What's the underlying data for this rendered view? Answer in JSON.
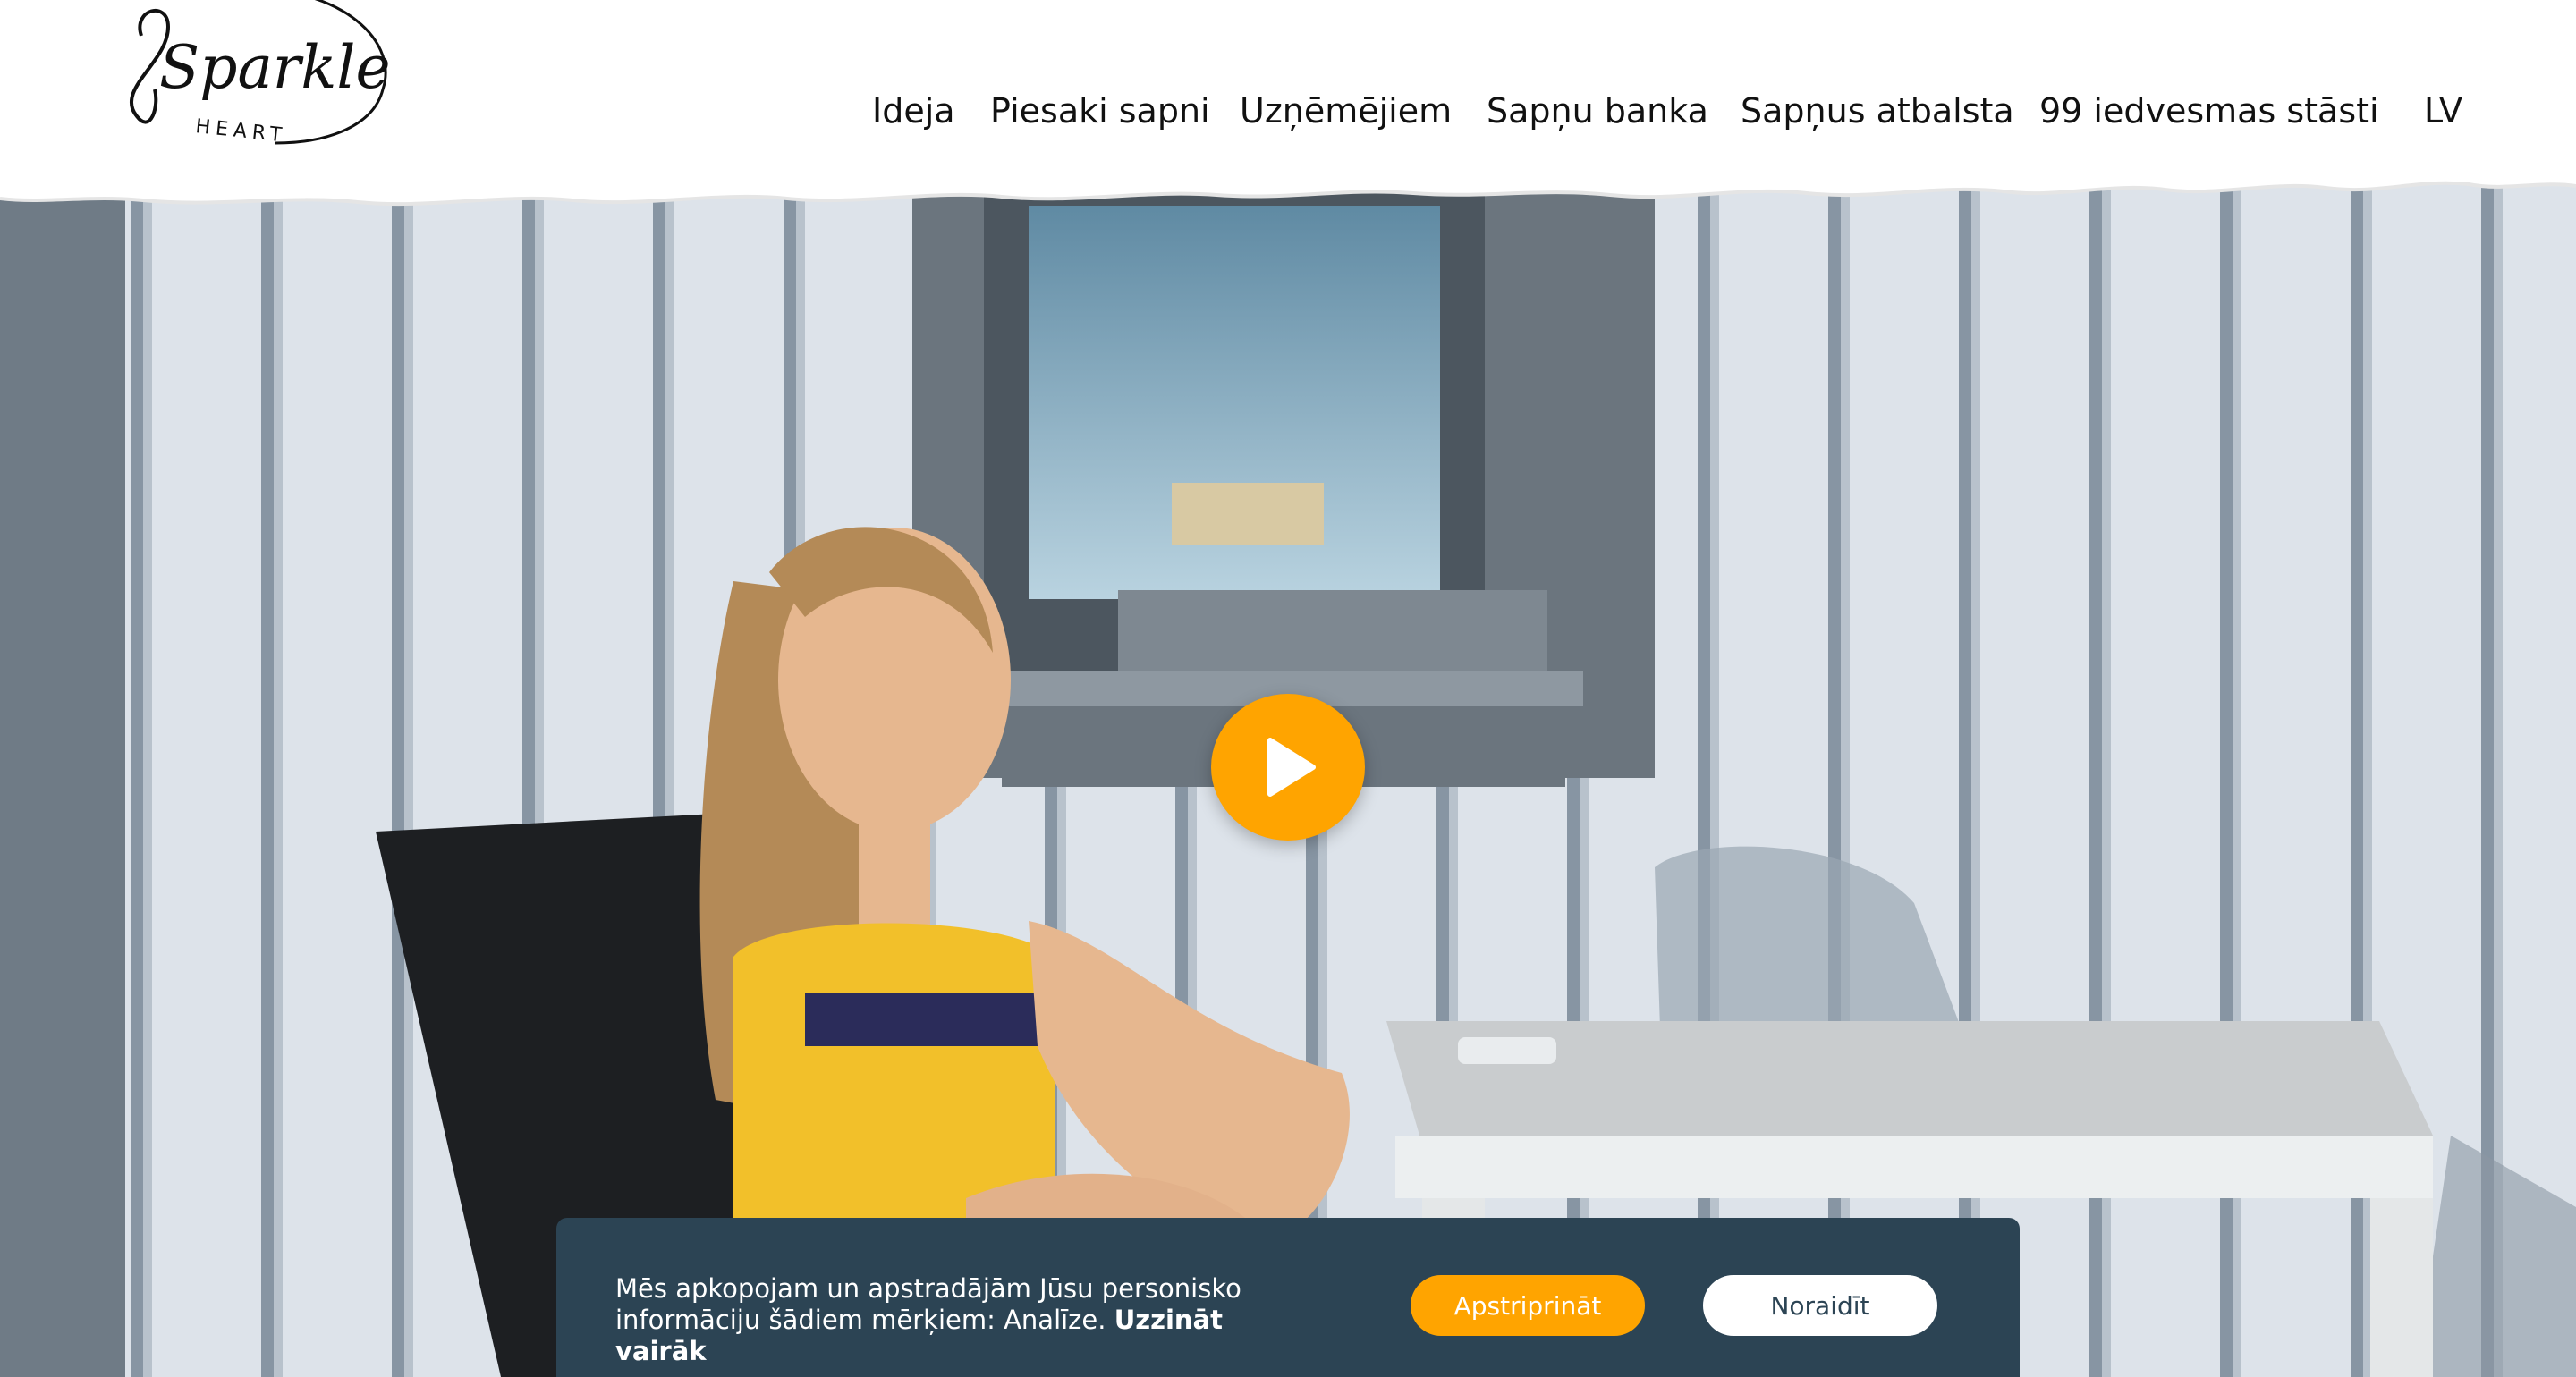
{
  "logo": {
    "name": "Sparkle",
    "sub": "HEART"
  },
  "nav": {
    "items": [
      {
        "label": "Ideja"
      },
      {
        "label": "Piesaki sapni"
      },
      {
        "label": "Uzņēmējiem"
      },
      {
        "label": "Sapņu banka"
      },
      {
        "label": "Sapņus atbalsta"
      },
      {
        "label": "99 iedvesmas stāsti"
      }
    ],
    "language": "LV"
  },
  "hero": {
    "play_icon": "play-icon"
  },
  "cookie": {
    "text": "Mēs apkopojam un apstradājām Jūsu personisko informāciju šādiem mērķiem: Analīze.",
    "link": "Uzzināt vairāk",
    "accept_label": "Apstriprināt",
    "reject_label": "Noraidīt"
  },
  "colors": {
    "accent": "#ffa400",
    "banner": "#2c4454"
  }
}
